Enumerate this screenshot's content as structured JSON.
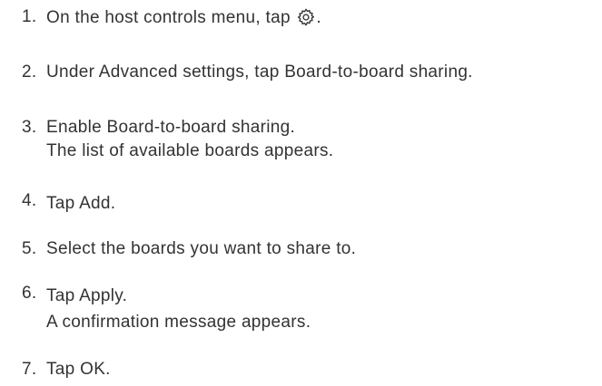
{
  "steps": [
    {
      "number": "1.",
      "text_before_icon": "On the host controls menu, tap",
      "icon": "gear-icon",
      "text_after_icon": "."
    },
    {
      "number": "2.",
      "text": "Under Advanced settings, tap Board-to-board sharing."
    },
    {
      "number": "3.",
      "text": "Enable Board-to-board sharing.",
      "result": "The list of available boards appears."
    },
    {
      "number": "4.",
      "text": "Tap Add."
    },
    {
      "number": "5.",
      "text": "Select the boards you want to share to."
    },
    {
      "number": "6.",
      "text": "Tap Apply.",
      "result": "A confirmation message appears."
    },
    {
      "number": "7.",
      "text": "Tap OK."
    }
  ],
  "colors": {
    "text": "#333333",
    "background": "#ffffff"
  }
}
